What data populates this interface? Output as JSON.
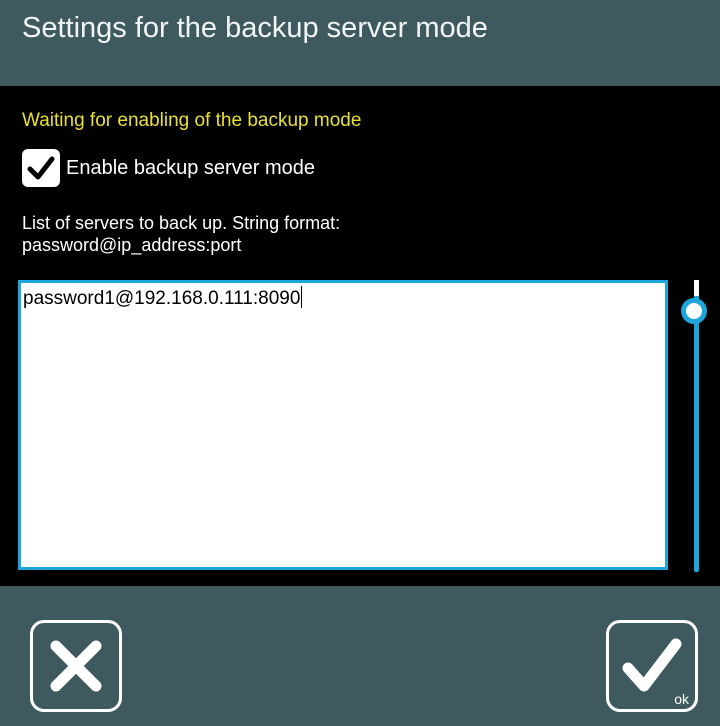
{
  "dialog": {
    "title": "Settings for the backup server mode",
    "status": "Waiting for enabling of the backup mode",
    "enable_checkbox": {
      "label": "Enable backup server mode",
      "checked": true
    },
    "help_text_line1": "List of servers to back up. String format:",
    "help_text_line2": "password@ip_address:port",
    "servers_value": "password1@192.168.0.111:8090"
  },
  "footer": {
    "cancel_icon": "close-icon",
    "ok_icon": "checkmark-icon",
    "ok_label": "ok"
  },
  "colors": {
    "header_bg": "#3f5a5f",
    "content_bg": "#000000",
    "status_text": "#e8e036",
    "accent": "#1da6dc"
  }
}
